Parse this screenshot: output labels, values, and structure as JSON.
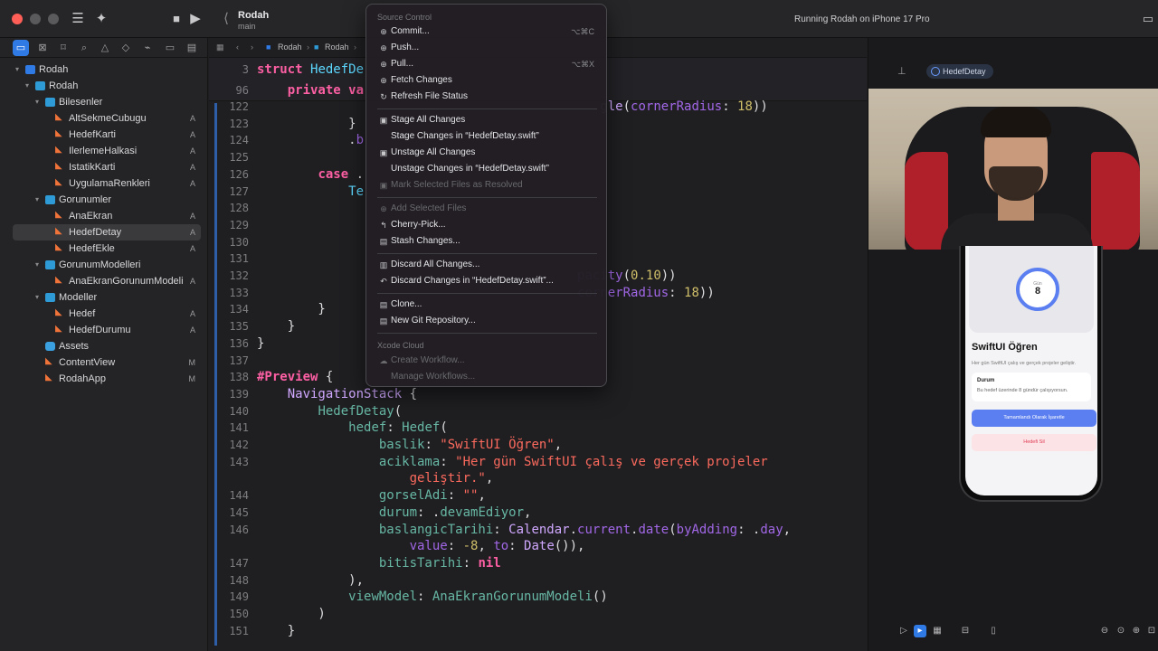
{
  "titlebar": {
    "project": "Rodah",
    "branch": "main",
    "run_status": "Running Rodah on iPhone 17 Pro"
  },
  "jumpbar": {
    "crumbs": [
      "Rodah",
      "Rodah"
    ]
  },
  "navigator": {
    "items": [
      {
        "label": "Rodah",
        "kind": "proj",
        "depth": 0,
        "badge": ""
      },
      {
        "label": "Rodah",
        "kind": "folder",
        "depth": 1,
        "badge": ""
      },
      {
        "label": "Bilesenler",
        "kind": "folder",
        "depth": 2,
        "badge": ""
      },
      {
        "label": "AltSekmeCubugu",
        "kind": "swift",
        "depth": 3,
        "badge": "A"
      },
      {
        "label": "HedefKarti",
        "kind": "swift",
        "depth": 3,
        "badge": "A"
      },
      {
        "label": "IlerlemeHalkasi",
        "kind": "swift",
        "depth": 3,
        "badge": "A"
      },
      {
        "label": "IstatikKarti",
        "kind": "swift",
        "depth": 3,
        "badge": "A"
      },
      {
        "label": "UygulamaRenkleri",
        "kind": "swift",
        "depth": 3,
        "badge": "A"
      },
      {
        "label": "Gorunumler",
        "kind": "folder",
        "depth": 2,
        "badge": ""
      },
      {
        "label": "AnaEkran",
        "kind": "swift",
        "depth": 3,
        "badge": "A"
      },
      {
        "label": "HedefDetay",
        "kind": "swift",
        "depth": 3,
        "badge": "A"
      },
      {
        "label": "HedefEkle",
        "kind": "swift",
        "depth": 3,
        "badge": "A"
      },
      {
        "label": "GorunumModelleri",
        "kind": "folder",
        "depth": 2,
        "badge": ""
      },
      {
        "label": "AnaEkranGorunumModeli",
        "kind": "swift",
        "depth": 3,
        "badge": "A"
      },
      {
        "label": "Modeller",
        "kind": "folder",
        "depth": 2,
        "badge": ""
      },
      {
        "label": "Hedef",
        "kind": "swift",
        "depth": 3,
        "badge": "A"
      },
      {
        "label": "HedefDurumu",
        "kind": "swift",
        "depth": 3,
        "badge": "A"
      },
      {
        "label": "Assets",
        "kind": "assets",
        "depth": 2,
        "badge": ""
      },
      {
        "label": "ContentView",
        "kind": "swift",
        "depth": 2,
        "badge": "M"
      },
      {
        "label": "RodahApp",
        "kind": "swift",
        "depth": 2,
        "badge": "M"
      }
    ],
    "selected_item": "HedefDetay"
  },
  "editor": {
    "sticky_lines": [
      {
        "num": "3",
        "html": "<span class=\"kw\">struct</span> <span class=\"ty\">HedefDe</span>"
      },
      {
        "num": "96",
        "html": "    <span class=\"kw\">private</span> <span class=\"kw\">va</span>"
      }
    ],
    "lines": [
      {
        "num": "122",
        "html": "                                             <span class=\"cl\">gle</span>(<span class=\"me\">cornerRadius</span>: <span class=\"nu\">18</span>))"
      },
      {
        "num": "123",
        "html": "            }"
      },
      {
        "num": "124",
        "html": "            .<span class=\"me\">b</span>"
      },
      {
        "num": "125",
        "html": ""
      },
      {
        "num": "126",
        "html": "        <span class=\"kw\">case</span> ."
      },
      {
        "num": "127",
        "html": "            <span class=\"ty\">Te</span>"
      },
      {
        "num": "128",
        "html": ""
      },
      {
        "num": "129",
        "html": ""
      },
      {
        "num": "130",
        "html": ""
      },
      {
        "num": "131",
        "html": ""
      },
      {
        "num": "132",
        "html": "                                          <span class=\"me\">pacity</span>(<span class=\"nu\">0.10</span>))"
      },
      {
        "num": "133",
        "html": "                                          <span class=\"me\">cornerRadius</span>: <span class=\"nu\">18</span>))"
      },
      {
        "num": "134",
        "html": "        }"
      },
      {
        "num": "135",
        "html": "    }"
      },
      {
        "num": "136",
        "html": "}"
      },
      {
        "num": "137",
        "html": ""
      },
      {
        "num": "138",
        "html": "<span class=\"kw\">#Preview</span> {"
      },
      {
        "num": "139",
        "html": "    <span class=\"cl\">NavigationStack</span> {"
      },
      {
        "num": "140",
        "html": "        <span class=\"fn\">HedefDetay</span>("
      },
      {
        "num": "141",
        "html": "            <span class=\"fn\">hedef</span>: <span class=\"fn\">Hedef</span>("
      },
      {
        "num": "142",
        "html": "                <span class=\"fn\">baslik</span>: <span class=\"st\">\"SwiftUI Öğren\"</span>,"
      },
      {
        "num": "143",
        "html": "                <span class=\"fn\">aciklama</span>: <span class=\"st\">\"Her gün SwiftUI çalış ve gerçek projeler</span>"
      },
      {
        "num": "",
        "html": "                    <span class=\"st\">geliştir.\"</span>,"
      },
      {
        "num": "144",
        "html": "                <span class=\"fn\">gorselAdi</span>: <span class=\"st\">\"\"</span>,"
      },
      {
        "num": "145",
        "html": "                <span class=\"fn\">durum</span>: .<span class=\"fn\">devamEdiyor</span>,"
      },
      {
        "num": "146",
        "html": "                <span class=\"fn\">baslangicTarihi</span>: <span class=\"cl\">Calendar</span>.<span class=\"me\">current</span>.<span class=\"me\">date</span>(<span class=\"me\">byAdding</span>: .<span class=\"me\">day</span>,"
      },
      {
        "num": "",
        "html": "                    <span class=\"me\">value</span>: <span class=\"nu\">-8</span>, <span class=\"me\">to</span>: <span class=\"cl\">Date</span>()),"
      },
      {
        "num": "147",
        "html": "                <span class=\"fn\">bitisTarihi</span>: <span class=\"kw\">nil</span>"
      },
      {
        "num": "148",
        "html": "            ),"
      },
      {
        "num": "149",
        "html": "            <span class=\"fn\">viewModel</span>: <span class=\"fn\">AnaEkranGorunumModeli</span>()"
      },
      {
        "num": "150",
        "html": "        )"
      },
      {
        "num": "151",
        "html": "    }"
      }
    ]
  },
  "menu": {
    "header": "Source Control",
    "footer_header": "Xcode Cloud",
    "items": [
      {
        "label": "Commit...",
        "icon": "commit-icon",
        "glyph": "⊕",
        "shortcut": "⌥⌘C",
        "disabled": false
      },
      {
        "label": "Push...",
        "icon": "push-icon",
        "glyph": "⊕",
        "shortcut": "",
        "disabled": false
      },
      {
        "label": "Pull...",
        "icon": "pull-icon",
        "glyph": "⊕",
        "shortcut": "⌥⌘X",
        "disabled": false
      },
      {
        "label": "Fetch Changes",
        "icon": "fetch-icon",
        "glyph": "⊕",
        "shortcut": "",
        "disabled": false
      },
      {
        "label": "Refresh File Status",
        "icon": "refresh-icon",
        "glyph": "↻",
        "shortcut": "",
        "disabled": false
      },
      {
        "sep": true
      },
      {
        "label": "Stage All Changes",
        "icon": "stage-icon",
        "glyph": "▣",
        "shortcut": "",
        "disabled": false
      },
      {
        "label": "Stage Changes in “HedefDetay.swift”",
        "icon": "",
        "glyph": "",
        "shortcut": "",
        "disabled": false
      },
      {
        "label": "Unstage All Changes",
        "icon": "unstage-icon",
        "glyph": "▣",
        "shortcut": "",
        "disabled": false
      },
      {
        "label": "Unstage Changes in “HedefDetay.swift”",
        "icon": "",
        "glyph": "",
        "shortcut": "",
        "disabled": false
      },
      {
        "label": "Mark Selected Files as Resolved",
        "icon": "resolve-icon",
        "glyph": "▣",
        "shortcut": "",
        "disabled": true
      },
      {
        "sep": true
      },
      {
        "label": "Add Selected Files",
        "icon": "add-icon",
        "glyph": "⊕",
        "shortcut": "",
        "disabled": true
      },
      {
        "label": "Cherry-Pick...",
        "icon": "cherry-pick-icon",
        "glyph": "↰",
        "shortcut": "",
        "disabled": false
      },
      {
        "label": "Stash Changes...",
        "icon": "stash-icon",
        "glyph": "▤",
        "shortcut": "",
        "disabled": false
      },
      {
        "sep": true
      },
      {
        "label": "Discard All Changes...",
        "icon": "trash-icon",
        "glyph": "▥",
        "shortcut": "",
        "disabled": false
      },
      {
        "label": "Discard Changes in “HedefDetay.swift”...",
        "icon": "discard-icon",
        "glyph": "↶",
        "shortcut": "",
        "disabled": false
      },
      {
        "sep": true
      },
      {
        "label": "Clone...",
        "icon": "clone-icon",
        "glyph": "▤",
        "shortcut": "",
        "disabled": false
      },
      {
        "label": "New Git Repository...",
        "icon": "repo-icon",
        "glyph": "▤",
        "shortcut": "",
        "disabled": false
      },
      {
        "sep": true
      },
      {
        "header": true
      },
      {
        "label": "Create Workflow...",
        "icon": "cloud-icon",
        "glyph": "☁",
        "shortcut": "",
        "disabled": true
      },
      {
        "label": "Manage Workflows...",
        "icon": "",
        "glyph": "",
        "shortcut": "",
        "disabled": true
      }
    ]
  },
  "canvas": {
    "preview_chip": "HedefDetay",
    "app": {
      "ring_label": "Gün",
      "ring_value": "8",
      "title": "SwiftUI Öğren",
      "description": "Her gün SwiftUI çalış ve gerçek projeler geliştir.",
      "status_heading": "Durum",
      "status_body": "Bu hedef üzerinde 8 gündür çalışıyorsun.",
      "complete_button": "Tamamlandı Olarak İşaretle",
      "delete_button": "Hedefi Sil"
    }
  },
  "colors": {
    "accent": "#2f7ae5",
    "app_primary": "#5b7ff0",
    "app_destructive": "#e23a52"
  }
}
